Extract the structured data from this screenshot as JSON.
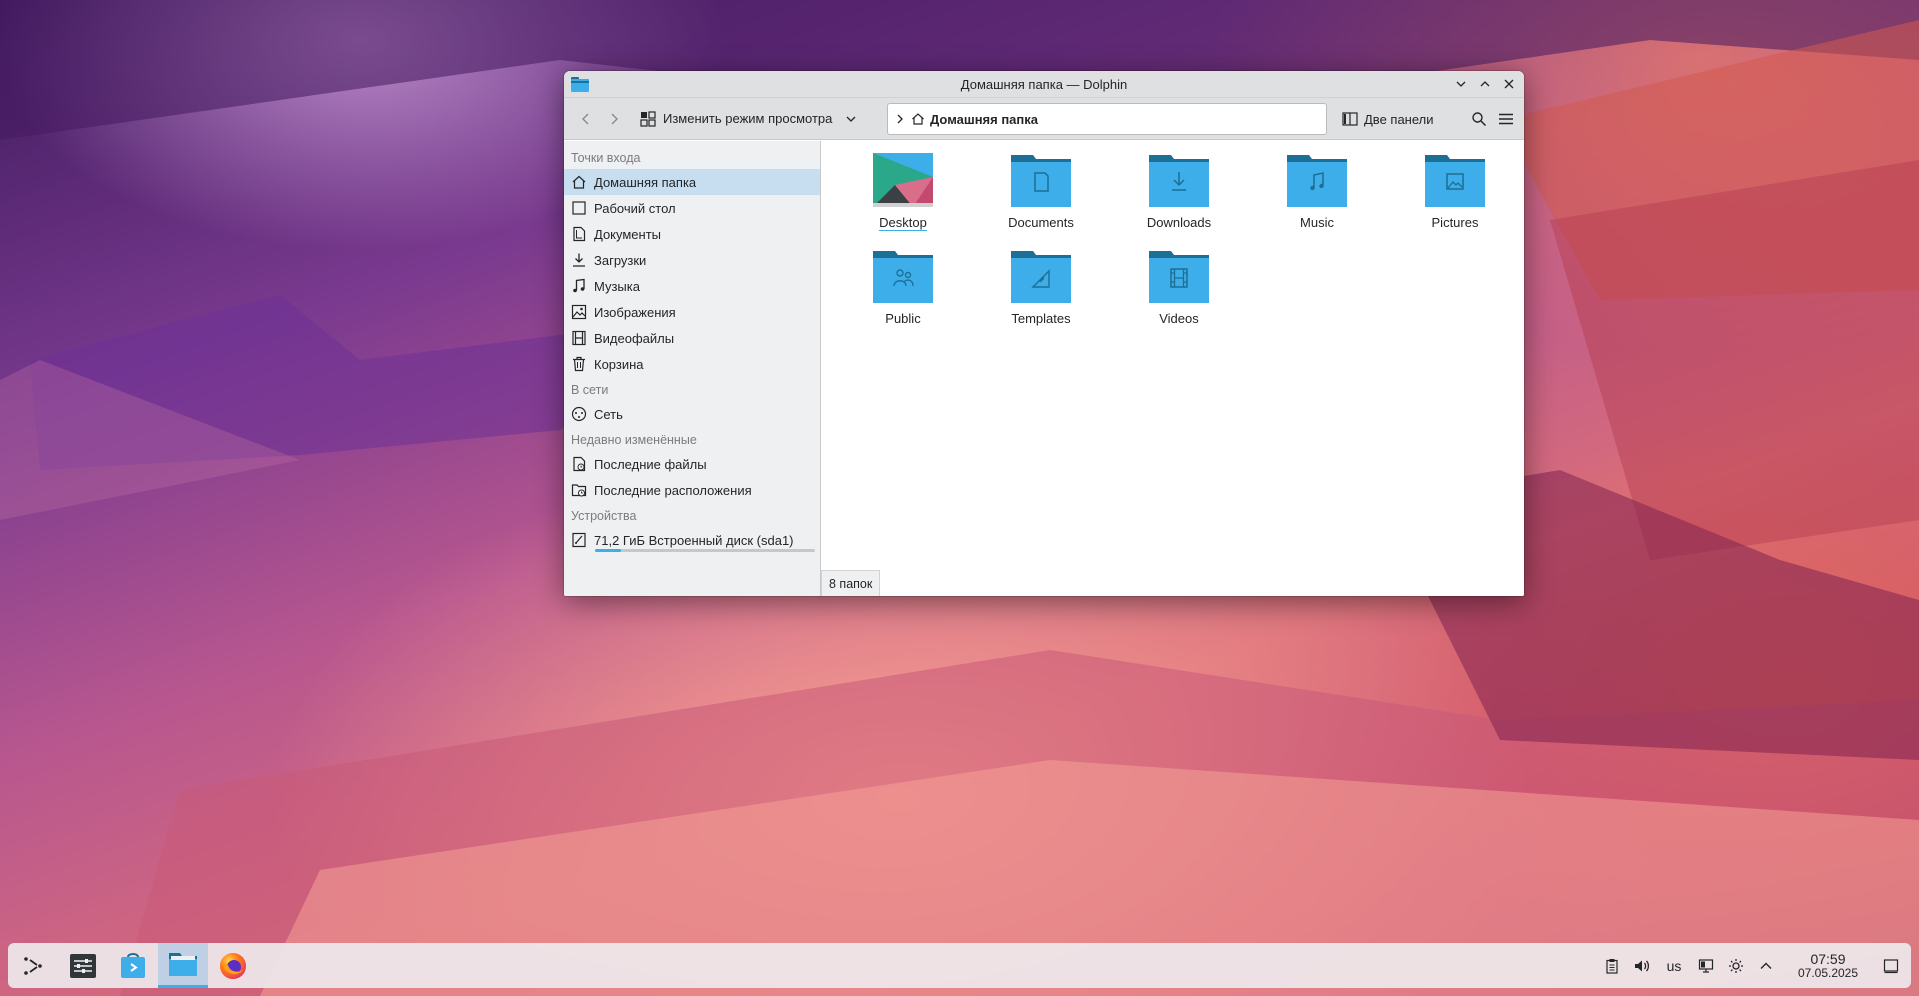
{
  "window": {
    "title": "Домашняя папка — Dolphin"
  },
  "toolbar": {
    "view_mode_label": "Изменить режим просмотра",
    "location": "Домашняя папка",
    "split_label": "Две панели"
  },
  "sidebar": {
    "sections": {
      "places": "Точки входа",
      "network": "В сети",
      "recent": "Недавно изменённые",
      "devices": "Устройства"
    },
    "places": [
      {
        "label": "Домашняя папка",
        "icon": "home-icon"
      },
      {
        "label": "Рабочий стол",
        "icon": "desktop-icon"
      },
      {
        "label": "Документы",
        "icon": "documents-icon"
      },
      {
        "label": "Загрузки",
        "icon": "downloads-icon"
      },
      {
        "label": "Музыка",
        "icon": "music-icon"
      },
      {
        "label": "Изображения",
        "icon": "pictures-icon"
      },
      {
        "label": "Видеофайлы",
        "icon": "videos-icon"
      },
      {
        "label": "Корзина",
        "icon": "trash-icon"
      }
    ],
    "network": [
      {
        "label": "Сеть",
        "icon": "network-icon"
      }
    ],
    "recent": [
      {
        "label": "Последние файлы",
        "icon": "recent-files-icon"
      },
      {
        "label": "Последние расположения",
        "icon": "recent-locations-icon"
      }
    ],
    "devices": [
      {
        "label": "71,2 ГиБ Встроенный диск (sda1)",
        "icon": "drive-icon",
        "usage_fraction": 0.12
      }
    ]
  },
  "files": [
    {
      "name": "Desktop",
      "icon": "desktop-thumbnail-icon"
    },
    {
      "name": "Documents",
      "icon": "folder-documents-icon"
    },
    {
      "name": "Downloads",
      "icon": "folder-downloads-icon"
    },
    {
      "name": "Music",
      "icon": "folder-music-icon"
    },
    {
      "name": "Pictures",
      "icon": "folder-pictures-icon"
    },
    {
      "name": "Public",
      "icon": "folder-public-icon"
    },
    {
      "name": "Templates",
      "icon": "folder-templates-icon"
    },
    {
      "name": "Videos",
      "icon": "folder-videos-icon"
    }
  ],
  "status": "8 папок",
  "taskbar": {
    "keyboard_layout": "us",
    "time": "07:59",
    "date": "07.05.2025"
  },
  "colors": {
    "accent": "#3daee9",
    "folder": "#3daee9",
    "folder_dark": "#1d6f96",
    "selection": "#c7def1"
  }
}
